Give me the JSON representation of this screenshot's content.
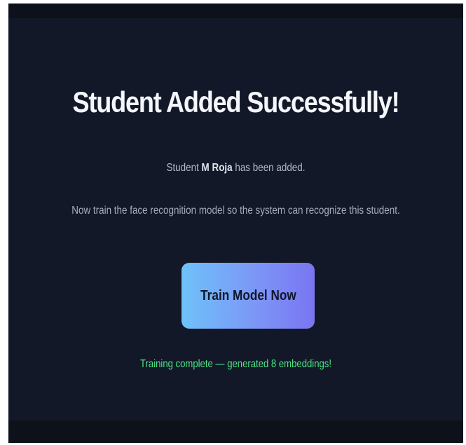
{
  "page": {
    "title": "Student Added Successfully!",
    "student_prefix": "Student ",
    "student_name": "M Roja",
    "student_suffix": " has been added.",
    "instructions": "Now train the face recognition model so the system can recognize this student."
  },
  "train_button": {
    "label": "Train Model Now"
  },
  "status": {
    "message": "Training complete — generated 8 embeddings!"
  },
  "colors": {
    "background": "#121827",
    "status_green": "#4ee388",
    "button_gradient_start": "#6fc2f9",
    "button_gradient_end": "#7a75f1"
  }
}
